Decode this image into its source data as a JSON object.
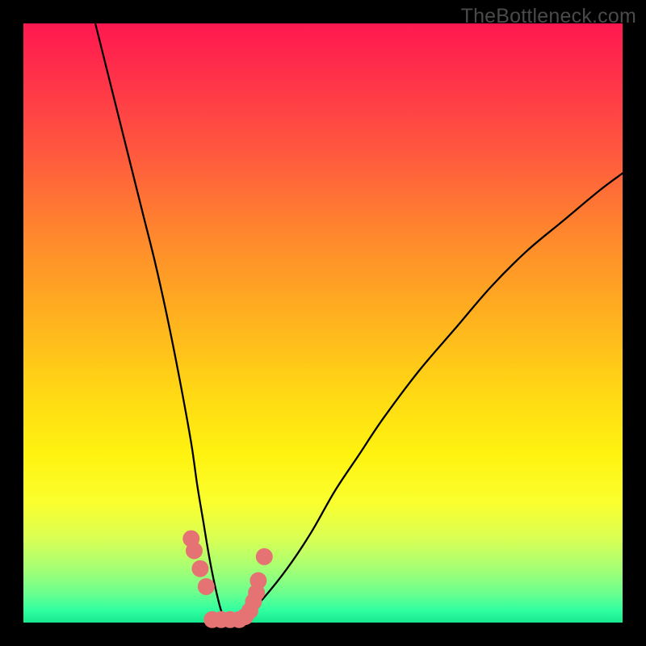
{
  "watermark": "TheBottleneck.com",
  "chart_data": {
    "type": "line",
    "title": "",
    "xlabel": "",
    "ylabel": "",
    "xlim": [
      0,
      100
    ],
    "ylim": [
      0,
      100
    ],
    "grid": false,
    "series": [
      {
        "name": "curve",
        "color": "#000000",
        "x": [
          12,
          14,
          16,
          18,
          20,
          22,
          24,
          26,
          28,
          29,
          30,
          31,
          32,
          33,
          34,
          35,
          36,
          37,
          40,
          44,
          48,
          52,
          56,
          60,
          66,
          72,
          78,
          84,
          90,
          96,
          100
        ],
        "y": [
          100,
          92,
          84,
          76,
          68,
          60,
          51,
          41,
          30,
          23,
          17,
          11,
          6,
          2,
          0,
          0,
          0,
          1,
          4,
          9,
          15,
          22,
          28,
          34,
          42,
          49,
          56,
          62,
          67,
          72,
          75
        ]
      },
      {
        "name": "markers-left",
        "color": "#e57373",
        "type": "scatter",
        "x": [
          28,
          28.5,
          29.5,
          30.5
        ],
        "y": [
          14,
          12,
          9,
          6
        ]
      },
      {
        "name": "markers-bottom",
        "color": "#e57373",
        "type": "scatter",
        "x": [
          31.5,
          33,
          34.5,
          36,
          37,
          37.8,
          38.4,
          38.9,
          39.2
        ],
        "y": [
          0.5,
          0.5,
          0.5,
          0.5,
          1,
          2,
          3.5,
          5,
          7
        ]
      },
      {
        "name": "markers-right-top",
        "color": "#e57373",
        "type": "scatter",
        "x": [
          40.2
        ],
        "y": [
          11
        ]
      }
    ]
  }
}
